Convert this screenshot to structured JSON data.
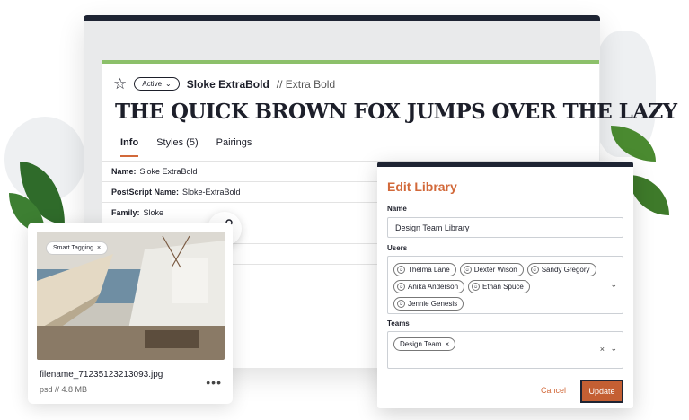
{
  "font_card": {
    "status_pill": "Active",
    "font_name": "Sloke ExtraBold",
    "font_style": "// Extra Bold",
    "sample_text": "THE QUICK BROWN FOX JUMPS OVER THE LAZY",
    "tabs": [
      {
        "label": "Info",
        "active": true
      },
      {
        "label": "Styles (5)",
        "active": false
      },
      {
        "label": "Pairings",
        "active": false
      }
    ],
    "info": [
      {
        "label": "Name:",
        "value": "Sloke ExtraBold"
      },
      {
        "label": "PostScript Name:",
        "value": "Sloke-ExtraBold"
      },
      {
        "label": "Family:",
        "value": "Sloke"
      }
    ]
  },
  "image_card": {
    "tag": "Smart Tagging",
    "file_name": "filename_71235123213093.jpg",
    "file_meta": "psd // 4.8 MB"
  },
  "modal": {
    "title": "Edit Library",
    "name_label": "Name",
    "name_value": "Design Team Library",
    "users_label": "Users",
    "users": [
      "Thelma Lane",
      "Dexter Wison",
      "Sandy Gregory",
      "Anika Anderson",
      "Ethan Spuce",
      "Jennie Genesis"
    ],
    "teams_label": "Teams",
    "teams": [
      "Design Team"
    ],
    "cancel_label": "Cancel",
    "update_label": "Update"
  },
  "colors": {
    "accent": "#d2693a",
    "header_bar": "#1e2433",
    "green_bar": "#8cc06a"
  }
}
